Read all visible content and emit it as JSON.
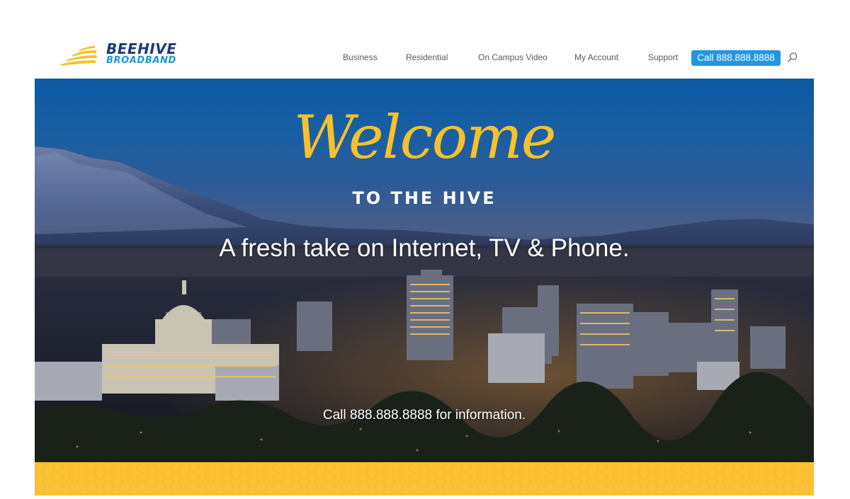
{
  "brand": {
    "line1": "BEEHIVE",
    "line2": "BROADBAND",
    "colors": {
      "navy": "#1c3a7d",
      "blue": "#1e96d8",
      "yellow": "#f8c12c"
    }
  },
  "nav": {
    "items": [
      {
        "label": "Business"
      },
      {
        "label": "Residential"
      },
      {
        "label": "On Campus Video"
      },
      {
        "label": "My Account"
      },
      {
        "label": "Support"
      }
    ],
    "call_button": "Call 888.888.8888",
    "search_icon": "search-icon",
    "accent": "#2196e6"
  },
  "hero": {
    "welcome": "Welcome",
    "subtitle": "TO THE HIVE",
    "tagline": "A fresh take on Internet, TV & Phone.",
    "info": "Call 888.888.8888 for information."
  },
  "footer_band": {
    "color": "#fcc234"
  }
}
